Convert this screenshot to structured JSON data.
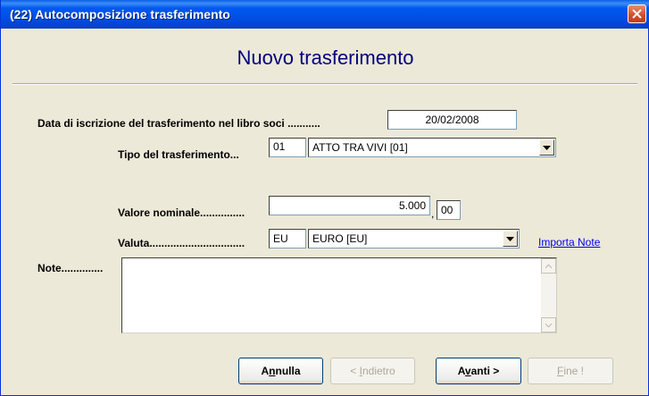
{
  "window": {
    "title": "(22) Autocomposizione trasferimento"
  },
  "heading": "Nuovo trasferimento",
  "form": {
    "data_label": "Data di iscrizione del trasferimento nel libro soci ...........",
    "data_value": "20/02/2008",
    "tipo_label": "Tipo del trasferimento...",
    "tipo_code": "01",
    "tipo_selected": "ATTO TRA VIVI [01]",
    "valore_label": "Valore nominale...............",
    "valore_int": "5.000",
    "valore_sep": ",",
    "valore_dec": "00",
    "valuta_label": "Valuta................................",
    "valuta_code": "EU",
    "valuta_selected": "EURO [EU]",
    "importa_note_link": "Importa Note",
    "note_label": "Note..............",
    "note_value": ""
  },
  "buttons": {
    "annulla_pre": "A",
    "annulla_u": "n",
    "annulla_post": "nulla",
    "indietro_pre": "< ",
    "indietro_u": "I",
    "indietro_post": "ndietro",
    "avanti_pre": "A",
    "avanti_u": "v",
    "avanti_post": "anti >",
    "fine_u": "F",
    "fine_post": "ine !"
  },
  "icons": {
    "close": "close-icon",
    "combo_arrow": "chevron-down-icon",
    "scroll_up": "scroll-up-icon",
    "scroll_down": "scroll-down-icon"
  }
}
